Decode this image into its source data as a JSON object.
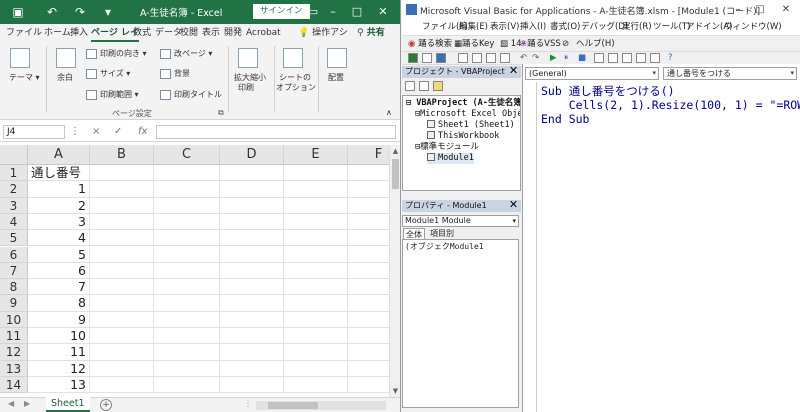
{
  "excel": {
    "title": "A-生徒名簿 - Excel",
    "signin_label": "サインイン",
    "tabs": [
      "ファイル",
      "ホーム",
      "挿入",
      "ページ レイ",
      "数式",
      "データ",
      "校閲",
      "表示",
      "開発",
      "Acrobat"
    ],
    "tell_me": "操作アシ",
    "share_label": "共有",
    "ribbon": {
      "themes": "テーマ",
      "margins": "余白",
      "orientation": "印刷の向き",
      "size": "サイズ",
      "print_area": "印刷範囲",
      "breaks": "改ページ",
      "background": "背景",
      "print_titles": "印刷タイトル",
      "group_label": "ページ設定",
      "scale_to_fit": [
        "拡大縮小",
        "印刷"
      ],
      "sheet_options": [
        "シートの",
        "オプション"
      ],
      "arrange": "配置"
    },
    "name_box": "J4",
    "formula_symbols": [
      "×",
      "✓",
      "fx"
    ],
    "columns": [
      "A",
      "B",
      "C",
      "D",
      "E",
      "F"
    ],
    "rows": [
      {
        "row": "1",
        "a": "通し番号"
      },
      {
        "row": "2",
        "a": "1"
      },
      {
        "row": "3",
        "a": "2"
      },
      {
        "row": "4",
        "a": "3"
      },
      {
        "row": "5",
        "a": "4"
      },
      {
        "row": "6",
        "a": "5"
      },
      {
        "row": "7",
        "a": "6"
      },
      {
        "row": "8",
        "a": "7"
      },
      {
        "row": "9",
        "a": "8"
      },
      {
        "row": "10",
        "a": "9"
      },
      {
        "row": "11",
        "a": "10"
      },
      {
        "row": "12",
        "a": "11"
      },
      {
        "row": "13",
        "a": "12"
      },
      {
        "row": "14",
        "a": "13"
      }
    ],
    "sheet_tab": "Sheet1"
  },
  "vbe": {
    "title": "Microsoft Visual Basic for Applications - A-生徒名簿.xlsm - [Module1 (コード)]",
    "menus": [
      "ファイル(F)",
      "編集(E)",
      "表示(V)",
      "挿入(I)",
      "書式(O)",
      "デバッグ(D)",
      "実行(R)",
      "ツール(T)",
      "アドイン(A)",
      "ウィンドウ(W)"
    ],
    "toolbar1": [
      "踊る検索",
      "踊るKey",
      "14",
      "踊るVSS",
      "ヘルプ(H)"
    ],
    "project_pane_title": "プロジェクト - VBAProject",
    "tree": [
      "VBAProject (A-生徒名簿",
      "Microsoft Excel Object",
      "Sheet1 (Sheet1)",
      "ThisWorkbook",
      "標準モジュール",
      "Module1"
    ],
    "properties_title": "プロパティ - Module1",
    "properties_combo": "Module1  Module",
    "prop_tabs": [
      "全体",
      "項目別"
    ],
    "prop_row": "(オブジェクModule1",
    "combo_object": "(General)",
    "combo_proc": "通し番号をつける",
    "code_lines": [
      "Sub 通し番号をつける()",
      "    Cells(2, 1).Resize(100, 1) = \"=ROW(A",
      "End Sub"
    ]
  }
}
